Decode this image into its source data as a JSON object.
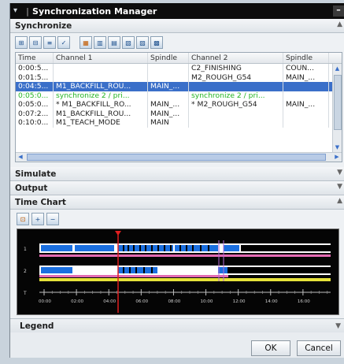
{
  "window": {
    "title": "Synchronization Manager",
    "minimize_glyph": "–"
  },
  "sections": {
    "synchronize": "Synchronize",
    "simulate": "Simulate",
    "output": "Output",
    "time_chart": "Time Chart",
    "legend": "Legend"
  },
  "table": {
    "headers": [
      "Time",
      "Channel 1",
      "Spindle",
      "Channel 2",
      "Spindle"
    ],
    "rows": [
      [
        "0:00:5...",
        "",
        "",
        "C2_FINISHING",
        "COUN..."
      ],
      [
        "0:01:5...",
        "",
        "",
        "M2_ROUGH_G54",
        "MAIN_..."
      ],
      [
        "0:04:5...",
        "M1_BACKFILL_ROU...",
        "MAIN_...",
        "",
        ""
      ],
      [
        "0:05:0...",
        "synchronize 2 / pri...",
        "",
        "synchronize 2 / pri...",
        ""
      ],
      [
        "0:05:0...",
        "* M1_BACKFILL_RO...",
        "MAIN_...",
        "* M2_ROUGH_G54",
        "MAIN_..."
      ],
      [
        "0:07:2...",
        "M1_BACKFILL_ROU...",
        "MAIN_...",
        "",
        ""
      ],
      [
        "0:10:0...",
        "M1_TEACH_MODE",
        "MAIN",
        "",
        ""
      ]
    ],
    "selected_row": 2,
    "green_row": 3
  },
  "chart": {
    "channel_labels": [
      "1",
      "2",
      "T"
    ],
    "time_ticks": [
      "00:00",
      "02:00",
      "04:00",
      "06:00",
      "08:00",
      "10:00",
      "12:00",
      "14:00",
      "16:00"
    ],
    "colors": {
      "blue": "#1a6fe0",
      "black": "#000000",
      "white": "#ffffff",
      "pink": "#e36ab2",
      "yellow": "#e6e23a",
      "marker": "#e01f1f",
      "purple": "#b56ad6"
    }
  },
  "buttons": {
    "ok": "OK",
    "cancel": "Cancel"
  },
  "icons": {
    "toolbar": [
      "sync-add-icon",
      "sync-remove-icon",
      "sync-edit-icon",
      "sync-check-icon",
      "grid-view-icon",
      "columns-icon",
      "filter-icon",
      "sort-icon",
      "export-icon",
      "import-icon"
    ],
    "tc_toolbar": [
      "fit-icon",
      "zoom-in-icon",
      "zoom-out-icon"
    ]
  }
}
